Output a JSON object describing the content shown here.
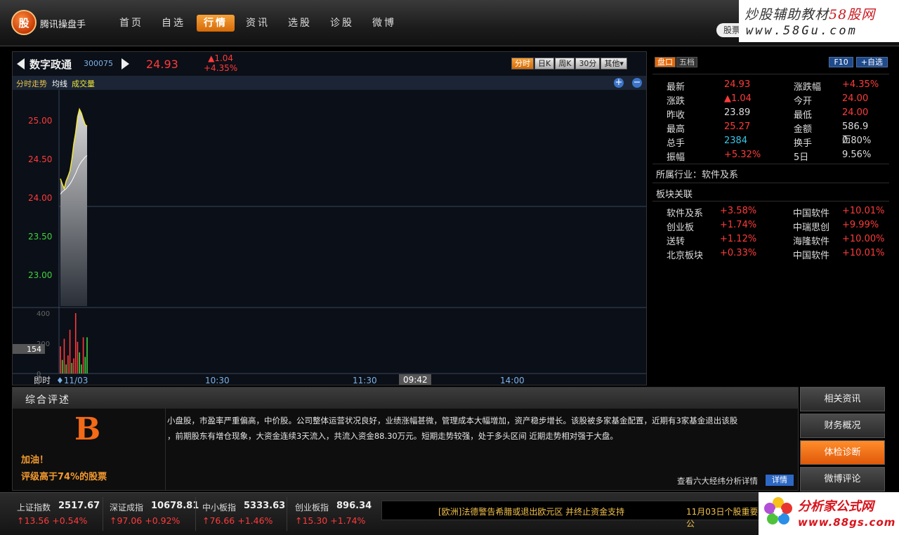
{
  "app": {
    "logo_text": "股",
    "title": "腾讯操盘手",
    "search_hint": "股票"
  },
  "nav": [
    "首页",
    "自选",
    "行情",
    "资讯",
    "选股",
    "诊股",
    "微博"
  ],
  "watermark_top": {
    "line1_a": "炒股辅助教材",
    "line1_b": "58股网",
    "line2": "www.58Gu.com"
  },
  "stock": {
    "name": "数字政通",
    "code": "300075",
    "price": "24.93",
    "change": "▲1.04",
    "change_pct": "+4.35%"
  },
  "period_tabs": [
    "分时",
    "日K",
    "周K",
    "30分",
    "其他▾"
  ],
  "legend": {
    "a": "分时走势",
    "b": "均线",
    "c": "成交量",
    "zoom_in": "+",
    "zoom_out": "−"
  },
  "chart_data": {
    "type": "line",
    "price_ticks": [
      "25.00",
      "24.50",
      "24.00",
      "23.50",
      "23.00"
    ],
    "price_range": [
      22.6,
      25.4
    ],
    "price": [
      24.25,
      24.18,
      24.12,
      24.22,
      24.28,
      24.35,
      24.5,
      24.7,
      24.85,
      25.05,
      25.15,
      25.1,
      25.02,
      24.95,
      24.93
    ],
    "avg": [
      24.05,
      24.08,
      24.1,
      24.12,
      24.15,
      24.18,
      24.22,
      24.27,
      24.32,
      24.38,
      24.43,
      24.47,
      24.5,
      24.53,
      24.55
    ],
    "volume_ticks": [
      "400",
      "200",
      "0"
    ],
    "volume_max": 400,
    "volume": [
      180,
      90,
      230,
      60,
      120,
      290,
      70,
      100,
      400,
      210,
      140,
      60,
      240,
      110,
      240
    ],
    "volume_up": [
      false,
      true,
      false,
      true,
      false,
      false,
      true,
      false,
      false,
      false,
      true,
      true,
      false,
      true,
      true
    ],
    "volume_marker": "154",
    "time_labels": [
      "11/03",
      "10:30",
      "11:30",
      "14:00"
    ],
    "time_prefix": "即时",
    "cursor_time": "09:42"
  },
  "quote": {
    "tabs": [
      "盘口",
      "五档"
    ],
    "buttons": [
      "F10",
      "+自选"
    ],
    "rows": [
      [
        "最新",
        "24.93",
        "涨跌幅",
        "+4.35%"
      ],
      [
        "涨跌",
        "▲1.04",
        "今开",
        "24.00"
      ],
      [
        "昨收",
        "23.89",
        "最低",
        "24.00"
      ],
      [
        "最高",
        "25.27",
        "金额",
        "586.9万"
      ],
      [
        "总手",
        "2384",
        "换手",
        "0.80%"
      ],
      [
        "振幅",
        "+5.32%",
        "5日",
        "9.56%"
      ]
    ],
    "industry": "所属行业：软件及系",
    "sector_title": "板块关联",
    "sectors": [
      [
        "软件及系",
        "+3.58%",
        "中国软件",
        "+10.01%"
      ],
      [
        "创业板",
        "+1.74%",
        "中瑞思创",
        "+9.99%"
      ],
      [
        "送转",
        "+1.12%",
        "海隆软件",
        "+10.00%"
      ],
      [
        "北京板块",
        "+0.33%",
        "中国软件",
        "+10.01%"
      ]
    ]
  },
  "review": {
    "title": "综合评述",
    "grade": "B",
    "cheer": "加油！",
    "grade_desc": "评级高于74%的股票",
    "line1": "小盘股，市盈率严重偏高，中价股。公司整体运营状况良好，业绩涨幅甚微，管理成本大幅增加，资产稳步增长。该股被多家基金配置，近期有3家基金退出该股",
    "line2": "，前期股东有增仓现象，大资金连续3天流入，共流入资金88.30万元。短期走势较强，处于多头区间 近期走势相对强于大盘。",
    "detail_link": "查看六大经纬分析详情",
    "detail_btn": "详情"
  },
  "side_buttons": [
    "相关资讯",
    "财务概况",
    "体检诊断",
    "微博评论"
  ],
  "indices": [
    {
      "name": "上证指数",
      "value": "2517.67",
      "change": "↑13.56  +0.54%"
    },
    {
      "name": "深证成指",
      "value": "10678.81",
      "change": "↑97.06  +0.92%"
    },
    {
      "name": "中小板指",
      "value": "5333.63",
      "change": "↑76.66  +1.46%"
    },
    {
      "name": "创业板指",
      "value": "896.34",
      "change": "↑15.30  +1.74%"
    }
  ],
  "news": {
    "a": "[欧洲]法德警告希腊或退出欧元区 并终止资金支持",
    "b": "11月03日个股重要公"
  },
  "watermark_bottom": {
    "line1": "分析家公式网",
    "line2": "www.88gs.com"
  },
  "colors": {
    "up": "#ff3b3b",
    "down": "#3fd33f",
    "accent": "#e2670a",
    "price_line": "#f0e83a"
  }
}
